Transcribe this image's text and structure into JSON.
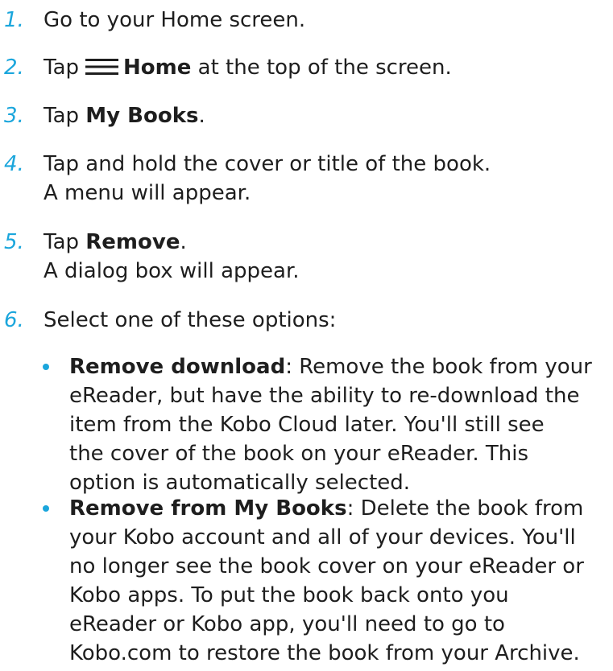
{
  "steps": [
    {
      "number": "1.",
      "text": "Go to your Home screen."
    },
    {
      "number": "2.",
      "before": "Tap",
      "bold": "Home",
      "after": "at the top of the screen."
    },
    {
      "number": "3.",
      "before": "Tap",
      "bold": "My Books",
      "after": "."
    },
    {
      "number": "4.",
      "line1": "Tap and hold the cover or title of the book.",
      "line2": "A menu will appear."
    },
    {
      "number": "5.",
      "before": "Tap",
      "bold": "Remove",
      "after": ".",
      "line2": "A dialog box will appear."
    },
    {
      "number": "6.",
      "text": "Select one of these options:"
    }
  ],
  "options": [
    {
      "title": "Remove download",
      "lines": [
        ": Remove the book from your",
        "eReader, but have the ability to re-download the",
        "item from the Kobo Cloud later. You'll still see",
        "the cover of the book on your eReader. This",
        "option is automatically selected."
      ]
    },
    {
      "title": "Remove from My Books",
      "lines": [
        ": Delete the book from",
        "your Kobo account and all of your devices. You'll",
        "no longer see the book cover on your eReader or",
        "Kobo apps. To put the book back onto you",
        "eReader or Kobo app, you'll need to go to",
        "Kobo.com to restore the book from your Archive."
      ]
    }
  ],
  "colors": {
    "accent": "#1ba6dc",
    "text": "#1e1e1e"
  },
  "icons": {
    "menu": "hamburger-menu-icon"
  }
}
